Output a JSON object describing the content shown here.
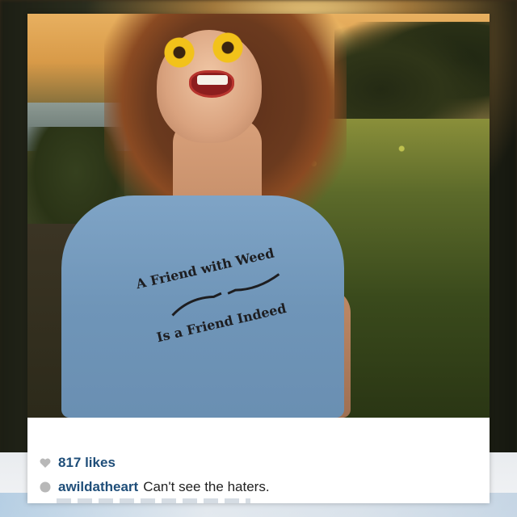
{
  "post": {
    "image_alt": "",
    "shirt_text": {
      "line1": "A Friend with Weed",
      "line2": "Is a Friend Indeed"
    },
    "likes": {
      "icon": "heart-icon",
      "label": "817 likes"
    },
    "caption": {
      "icon": "comment-icon",
      "username": "awildatheart",
      "text": "Can't see the haters."
    }
  },
  "colors": {
    "link_blue": "#1f4e79",
    "icon_gray": "#b8b8b8",
    "card_bg": "#ffffff"
  }
}
